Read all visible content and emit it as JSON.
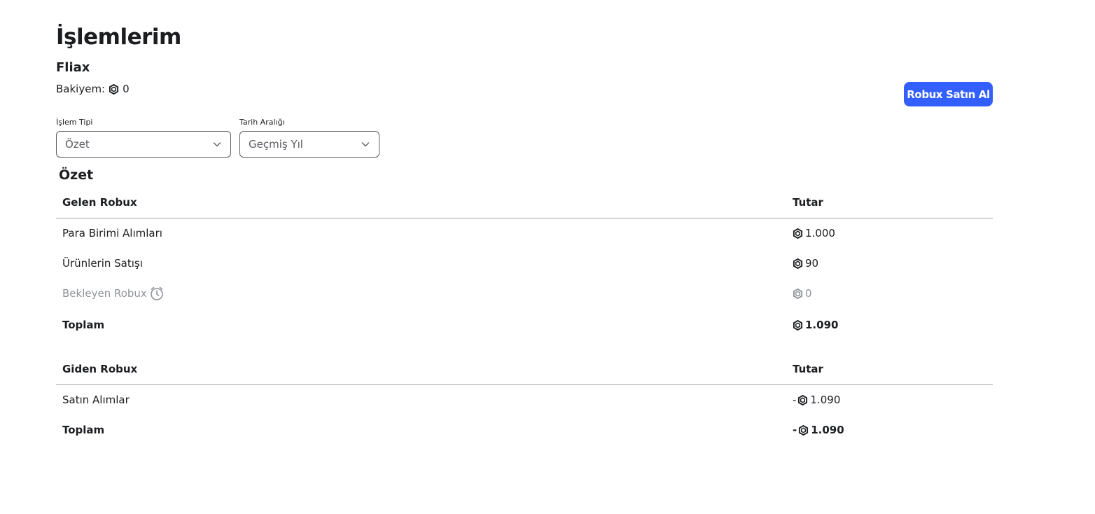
{
  "header": {
    "title": "İşlemlerim",
    "username": "Fliax",
    "balance_label": "Bakiyem:",
    "balance_value": "0",
    "buy_button": "Robux Satın Al"
  },
  "filters": {
    "type_label": "İşlem Tipi",
    "type_value": "Özet",
    "date_label": "Tarih Aralığı",
    "date_value": "Geçmiş Yıl"
  },
  "summary": {
    "title": "Özet",
    "incoming": {
      "header": "Gelen Robux",
      "amount_header": "Tutar",
      "rows": [
        {
          "label": "Para Birimi Alımları",
          "amount": "1.000"
        },
        {
          "label": "Ürünlerin Satışı",
          "amount": "90"
        },
        {
          "label": "Bekleyen Robux",
          "amount": "0"
        }
      ],
      "total_label": "Toplam",
      "total_amount": "1.090"
    },
    "outgoing": {
      "header": "Giden Robux",
      "amount_header": "Tutar",
      "rows": [
        {
          "label": "Satın Alımlar",
          "sign": "-",
          "amount": "1.090"
        }
      ],
      "total_label": "Toplam",
      "total_sign": "-",
      "total_amount": "1.090"
    }
  },
  "icons": {
    "robux": "robux-icon",
    "clock": "clock-icon",
    "chevron": "chevron-down-icon"
  },
  "colors": {
    "accent": "#335fff",
    "text": "#1b1d20",
    "muted": "#8f9399"
  }
}
